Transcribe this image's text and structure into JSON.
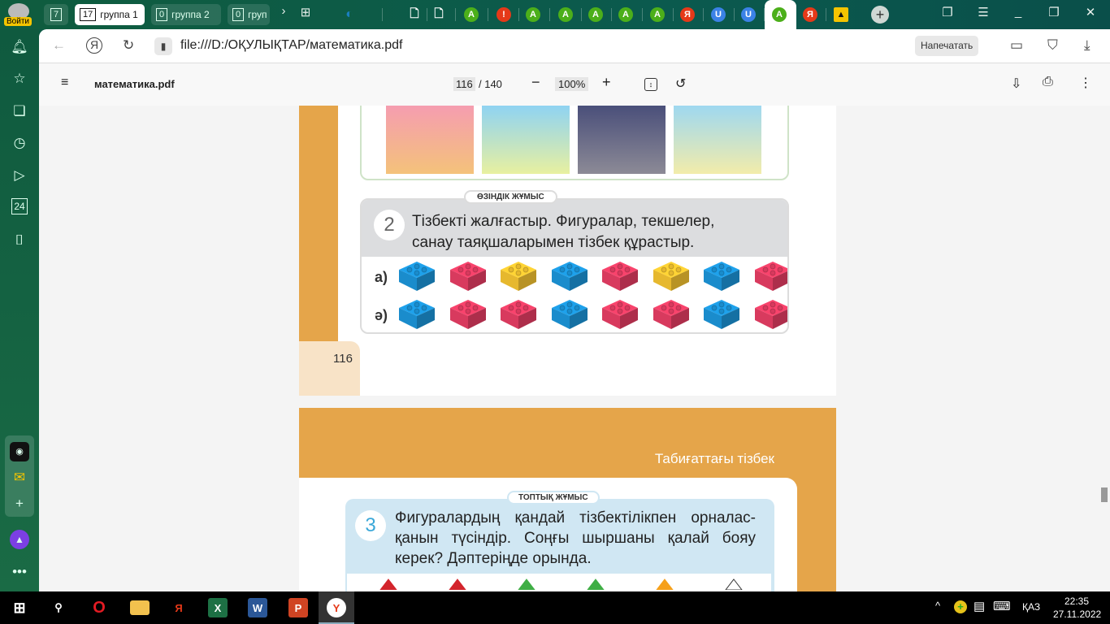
{
  "profile": {
    "login_label": "Войти"
  },
  "tabs": {
    "home_count": "7",
    "groups": [
      {
        "count": "17",
        "label": "группа 1"
      },
      {
        "count": "0",
        "label": "группа 2"
      },
      {
        "count": "0",
        "label": "груп"
      }
    ],
    "favicons": [
      {
        "icon": "globe-icon",
        "color": "#1a7fc0",
        "glyph": "◐"
      },
      {
        "icon": "document-icon",
        "color": "#ffffff",
        "glyph": "🗋"
      },
      {
        "icon": "document-icon",
        "color": "#ffffff",
        "glyph": "🗋"
      },
      {
        "icon": "a-icon",
        "color": "#4caf1a",
        "glyph": "A"
      },
      {
        "icon": "alert-icon",
        "color": "#e53919",
        "glyph": "!"
      },
      {
        "icon": "a-icon",
        "color": "#4caf1a",
        "glyph": "A"
      },
      {
        "icon": "a-icon",
        "color": "#4caf1a",
        "glyph": "A"
      },
      {
        "icon": "a-icon",
        "color": "#4caf1a",
        "glyph": "A"
      },
      {
        "icon": "a-icon",
        "color": "#4caf1a",
        "glyph": "A"
      },
      {
        "icon": "a-icon",
        "color": "#4caf1a",
        "glyph": "A"
      },
      {
        "icon": "yandex-icon",
        "color": "#e53919",
        "glyph": "Я"
      },
      {
        "icon": "u-icon",
        "color": "#3b82e6",
        "glyph": "U"
      },
      {
        "icon": "u-icon",
        "color": "#3b82e6",
        "glyph": "U"
      },
      {
        "icon": "a-icon",
        "color": "#4caf1a",
        "glyph": "A"
      },
      {
        "icon": "yandex-icon",
        "color": "#e53919",
        "glyph": "Я"
      },
      {
        "icon": "image-icon",
        "color": "#f5c400",
        "glyph": "▲"
      }
    ]
  },
  "address": {
    "url": "file:///D:/ОҚУЛЫҚТАР/математика.pdf",
    "print_label": "Напечатать"
  },
  "pdf": {
    "filename": "математика.pdf",
    "current_page": "116",
    "total_pages": "/ 140",
    "zoom": "100%"
  },
  "page1": {
    "task2": {
      "badge": "ӨЗІНДІК ЖҰМЫС",
      "number": "2",
      "line1": "Тізбекті жалғастыр. Фигуралар, текшелер,",
      "line2": "санау таяқшаларымен тізбек құрастыр.",
      "rows": [
        {
          "label": "а)",
          "bricks": [
            "#1a8ccc",
            "#d83a5e",
            "#e6b82e",
            "#1a8ccc",
            "#d83a5e",
            "#e6b82e",
            "#1a8ccc",
            "#d83a5e"
          ]
        },
        {
          "label": "ә)",
          "bricks": [
            "#1a8ccc",
            "#d83a5e",
            "#d83a5e",
            "#1a8ccc",
            "#d83a5e",
            "#d83a5e",
            "#1a8ccc",
            "#d83a5e"
          ]
        }
      ]
    },
    "page_number": "116"
  },
  "page2": {
    "section_title": "Табиғаттағы тізбек",
    "task3": {
      "badge": "ТОПТЫҚ ЖҰМЫС",
      "number": "3",
      "line1": "Фигуралардың қандай тізбектілікпен орналас-",
      "line2": "қанын түсіндір. Соңғы шыршаны қалай бояу",
      "line3": "керек? Дәптеріңде орында.",
      "trees": [
        "#d3242c",
        "#d3242c",
        "#3fae45",
        "#3fae45",
        "#f6a01a",
        "#ffffff"
      ]
    }
  },
  "tray": {
    "language": "ҚАЗ",
    "time": "22:35",
    "date": "27.11.2022"
  }
}
